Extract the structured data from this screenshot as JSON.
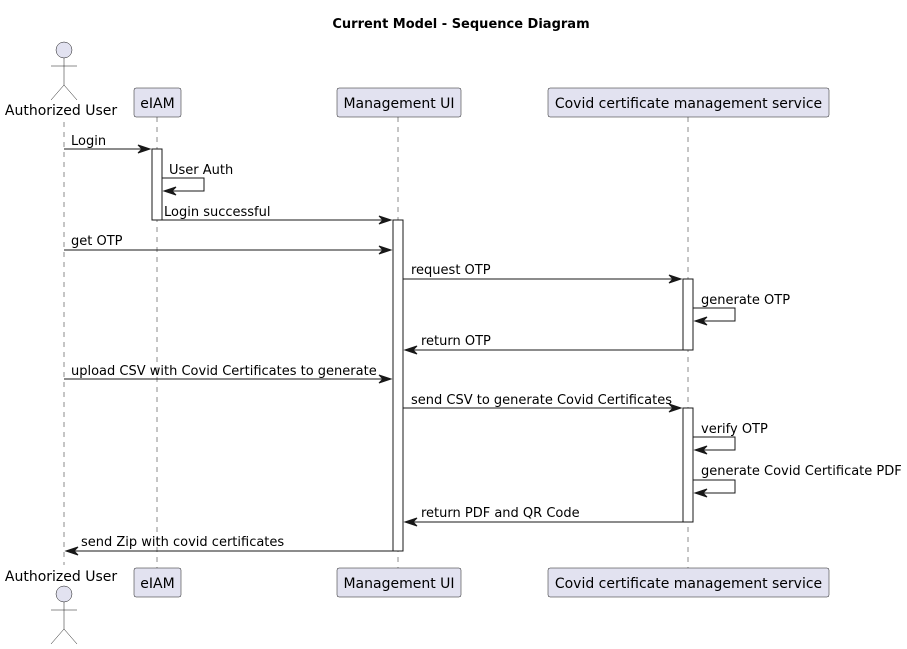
{
  "title": "Current Model - Sequence Diagram",
  "participants": [
    {
      "id": "user",
      "label": "Authorized User",
      "type": "actor"
    },
    {
      "id": "eiam",
      "label": "eIAM",
      "type": "participant"
    },
    {
      "id": "mgmt",
      "label": "Management UI",
      "type": "participant"
    },
    {
      "id": "covid",
      "label": "Covid certificate management service",
      "type": "participant"
    }
  ],
  "messages": [
    {
      "from": "user",
      "to": "eiam",
      "label": "Login"
    },
    {
      "from": "eiam",
      "to": "eiam",
      "label": "User Auth"
    },
    {
      "from": "eiam",
      "to": "mgmt",
      "label": "Login successful"
    },
    {
      "from": "user",
      "to": "mgmt",
      "label": "get OTP"
    },
    {
      "from": "mgmt",
      "to": "covid",
      "label": "request OTP"
    },
    {
      "from": "covid",
      "to": "covid",
      "label": "generate OTP"
    },
    {
      "from": "covid",
      "to": "mgmt",
      "label": "return OTP"
    },
    {
      "from": "user",
      "to": "mgmt",
      "label": "upload CSV with Covid Certificates to generate"
    },
    {
      "from": "mgmt",
      "to": "covid",
      "label": "send CSV to generate Covid Certificates"
    },
    {
      "from": "covid",
      "to": "covid",
      "label": "verify OTP"
    },
    {
      "from": "covid",
      "to": "covid",
      "label": "generate Covid Certificate PDF"
    },
    {
      "from": "covid",
      "to": "mgmt",
      "label": "return PDF and QR Code"
    },
    {
      "from": "mgmt",
      "to": "user",
      "label": "send Zip with covid certificates"
    }
  ],
  "colors": {
    "participant_fill": "#E2E2F0",
    "line": "#181818",
    "background": "#FFFFFF"
  }
}
